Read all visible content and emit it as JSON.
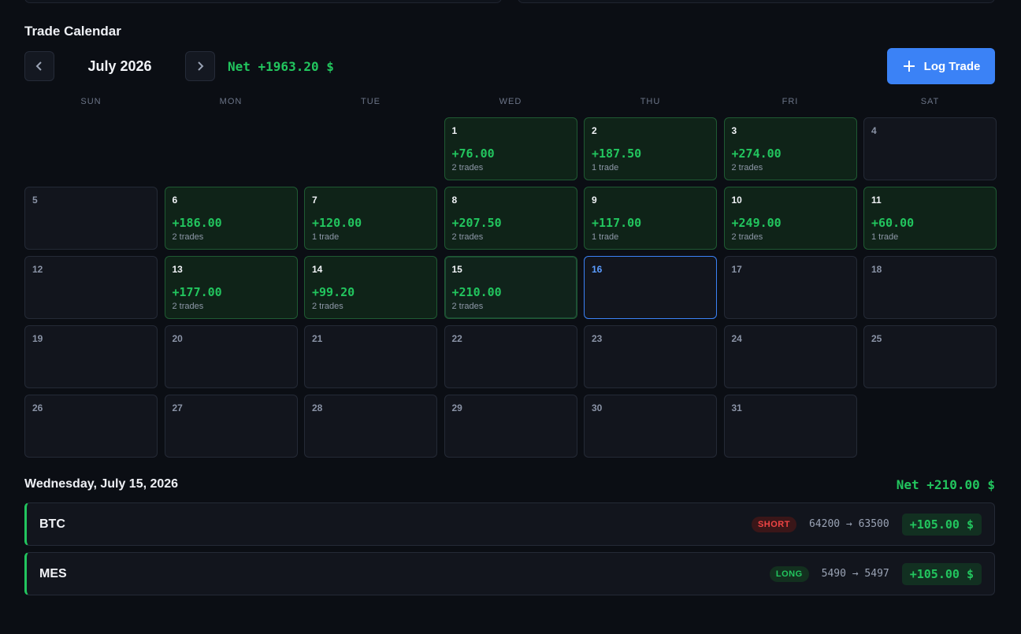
{
  "title": "Trade Calendar",
  "month_label": "July 2026",
  "month_net": "Net +1963.20 $",
  "log_trade_label": "Log Trade",
  "weekdays": [
    "SUN",
    "MON",
    "TUE",
    "WED",
    "THU",
    "FRI",
    "SAT"
  ],
  "days": [
    {
      "n": "1",
      "pnl": "+76.00",
      "trades": "2 trades"
    },
    {
      "n": "2",
      "pnl": "+187.50",
      "trades": "1 trade"
    },
    {
      "n": "3",
      "pnl": "+274.00",
      "trades": "2 trades"
    },
    {
      "n": "4"
    },
    {
      "n": "5"
    },
    {
      "n": "6",
      "pnl": "+186.00",
      "trades": "2 trades"
    },
    {
      "n": "7",
      "pnl": "+120.00",
      "trades": "1 trade"
    },
    {
      "n": "8",
      "pnl": "+207.50",
      "trades": "2 trades"
    },
    {
      "n": "9",
      "pnl": "+117.00",
      "trades": "1 trade"
    },
    {
      "n": "10",
      "pnl": "+249.00",
      "trades": "2 trades"
    },
    {
      "n": "11",
      "pnl": "+60.00",
      "trades": "1 trade"
    },
    {
      "n": "12"
    },
    {
      "n": "13",
      "pnl": "+177.00",
      "trades": "2 trades"
    },
    {
      "n": "14",
      "pnl": "+99.20",
      "trades": "2 trades"
    },
    {
      "n": "15",
      "pnl": "+210.00",
      "trades": "2 trades",
      "selected": true
    },
    {
      "n": "16",
      "today": true
    },
    {
      "n": "17"
    },
    {
      "n": "18"
    },
    {
      "n": "19"
    },
    {
      "n": "20"
    },
    {
      "n": "21"
    },
    {
      "n": "22"
    },
    {
      "n": "23"
    },
    {
      "n": "24"
    },
    {
      "n": "25"
    },
    {
      "n": "26"
    },
    {
      "n": "27"
    },
    {
      "n": "28"
    },
    {
      "n": "29"
    },
    {
      "n": "30"
    },
    {
      "n": "31"
    }
  ],
  "selected_day": {
    "title": "Wednesday, July 15, 2026",
    "net": "Net +210.00 $",
    "trades": [
      {
        "symbol": "BTC",
        "side": "SHORT",
        "route": "64200 → 63500",
        "pnl": "+105.00 $"
      },
      {
        "symbol": "MES",
        "side": "LONG",
        "route": "5490 → 5497",
        "pnl": "+105.00 $"
      }
    ]
  },
  "colors": {
    "accent": "#3b82f6",
    "profit": "#22c55e",
    "loss": "#ef4444"
  }
}
